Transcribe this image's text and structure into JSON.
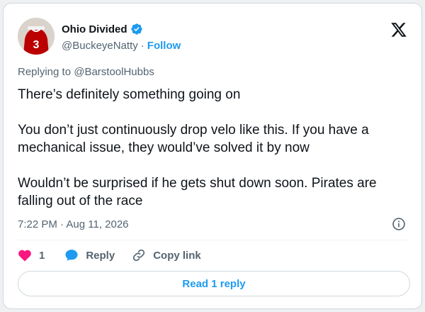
{
  "author": {
    "display_name": "Ohio Divided",
    "handle": "@BuckeyeNatty",
    "separator": "·",
    "follow_label": "Follow",
    "avatar_jersey_number": "3"
  },
  "reply_to": {
    "prefix": "Replying to",
    "mention": "@BarstoolHubbs"
  },
  "body": {
    "paragraphs": [
      "There’s definitely something going on",
      "You don’t just continuously drop velo like this. If you have a mechanical issue, they would’ve solved it by now",
      "Wouldn’t be surprised if he gets shut down soon. Pirates are falling out of the race"
    ]
  },
  "meta": {
    "time": "7:22 PM",
    "separator": "·",
    "date": "Aug 11, 2026"
  },
  "actions": {
    "like_count": "1",
    "reply_label": "Reply",
    "copy_link_label": "Copy link"
  },
  "read_replies_label": "Read 1 reply",
  "icons": {
    "verified": "verified-badge-icon",
    "logo": "x-logo-icon",
    "info": "info-icon",
    "like": "heart-icon",
    "reply": "speech-bubble-icon",
    "copy_link": "link-icon"
  },
  "colors": {
    "accent": "#1d9bf0",
    "like": "#f91880",
    "muted": "#536471",
    "text": "#0f1419",
    "jersey": "#bb0000"
  }
}
